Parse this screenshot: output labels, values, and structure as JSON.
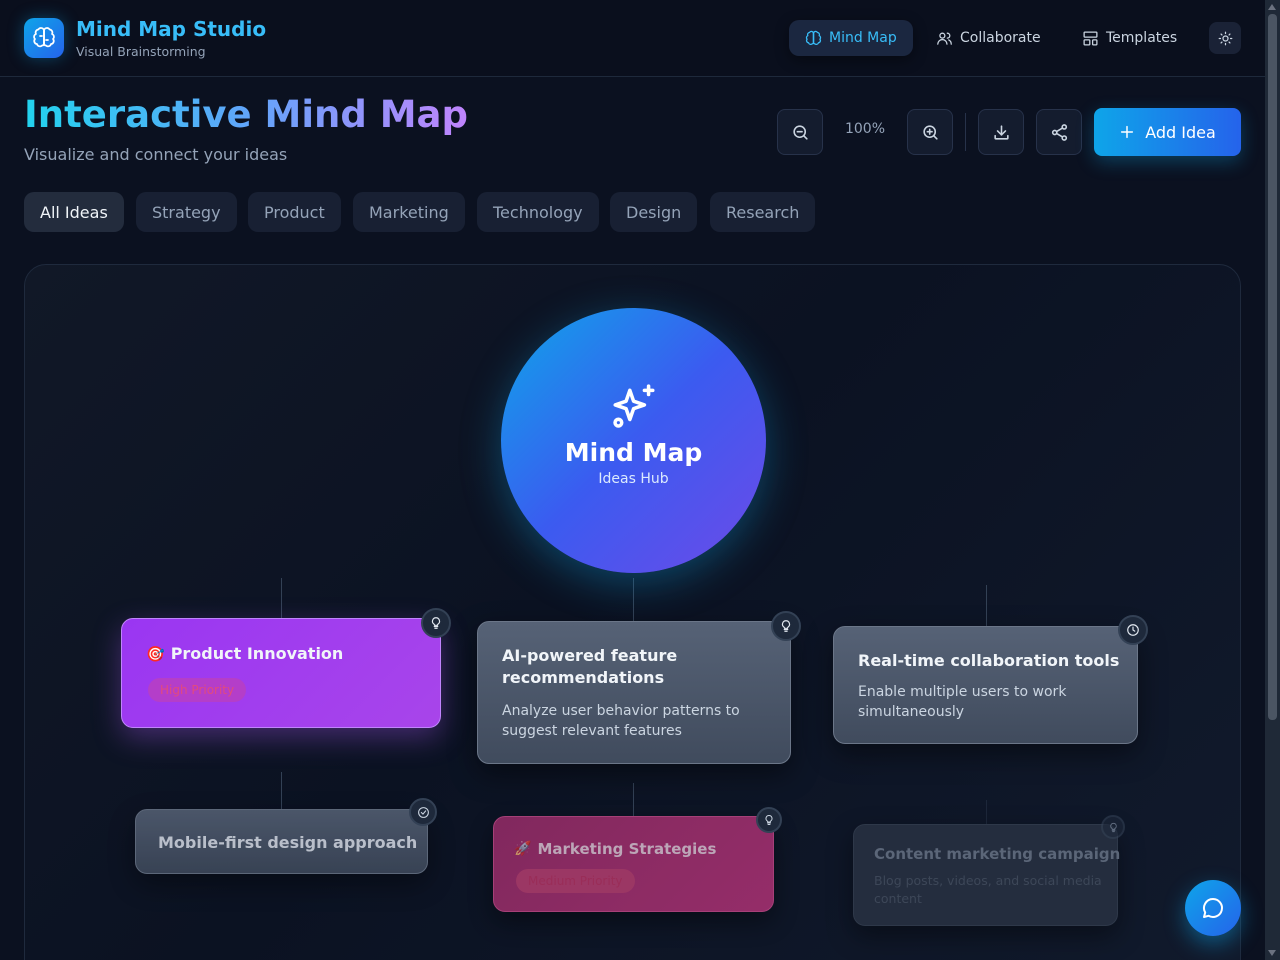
{
  "app": {
    "title": "Mind Map Studio",
    "subtitle": "Visual Brainstorming",
    "logo_icon": "brain-icon"
  },
  "nav": [
    {
      "label": "Mind Map",
      "icon": "brain-icon",
      "active": true
    },
    {
      "label": "Collaborate",
      "icon": "users-icon",
      "active": false
    },
    {
      "label": "Templates",
      "icon": "layout-icon",
      "active": false
    }
  ],
  "page": {
    "title": "Interactive Mind Map",
    "subtitle": "Visualize and connect your ideas"
  },
  "toolbar": {
    "zoom_level": "100%",
    "add_label": "Add Idea"
  },
  "filters": [
    "All Ideas",
    "Strategy",
    "Product",
    "Marketing",
    "Technology",
    "Design",
    "Research"
  ],
  "active_filter": "All Ideas",
  "center_node": {
    "title": "Mind Map",
    "subtitle": "Ideas Hub"
  },
  "nodes": [
    {
      "emoji": "🎯",
      "title": "Product Innovation",
      "priority": "High Priority",
      "status_icon": "lightbulb-icon",
      "color": "#a23ff0"
    },
    {
      "title": "AI-powered feature recommendations",
      "description": "Analyze user behavior patterns to suggest relevant features",
      "status_icon": "lightbulb-icon"
    },
    {
      "title": "Real-time collaboration tools",
      "description": "Enable multiple users to work simultaneously",
      "status_icon": "clock-icon"
    },
    {
      "title": "Mobile-first design approach",
      "status_icon": "check-circle-icon"
    },
    {
      "emoji": "🚀",
      "title": "Marketing Strategies",
      "priority": "Medium Priority",
      "status_icon": "lightbulb-icon",
      "color": "#9d2a6b"
    },
    {
      "title": "Content marketing campaign",
      "description": "Blog posts, videos, and social media content",
      "status_icon": "lightbulb-icon"
    }
  ],
  "colors": {
    "accent": "#38bdf8",
    "primary_button": "#0ea5e9",
    "background": "#0b1120"
  }
}
